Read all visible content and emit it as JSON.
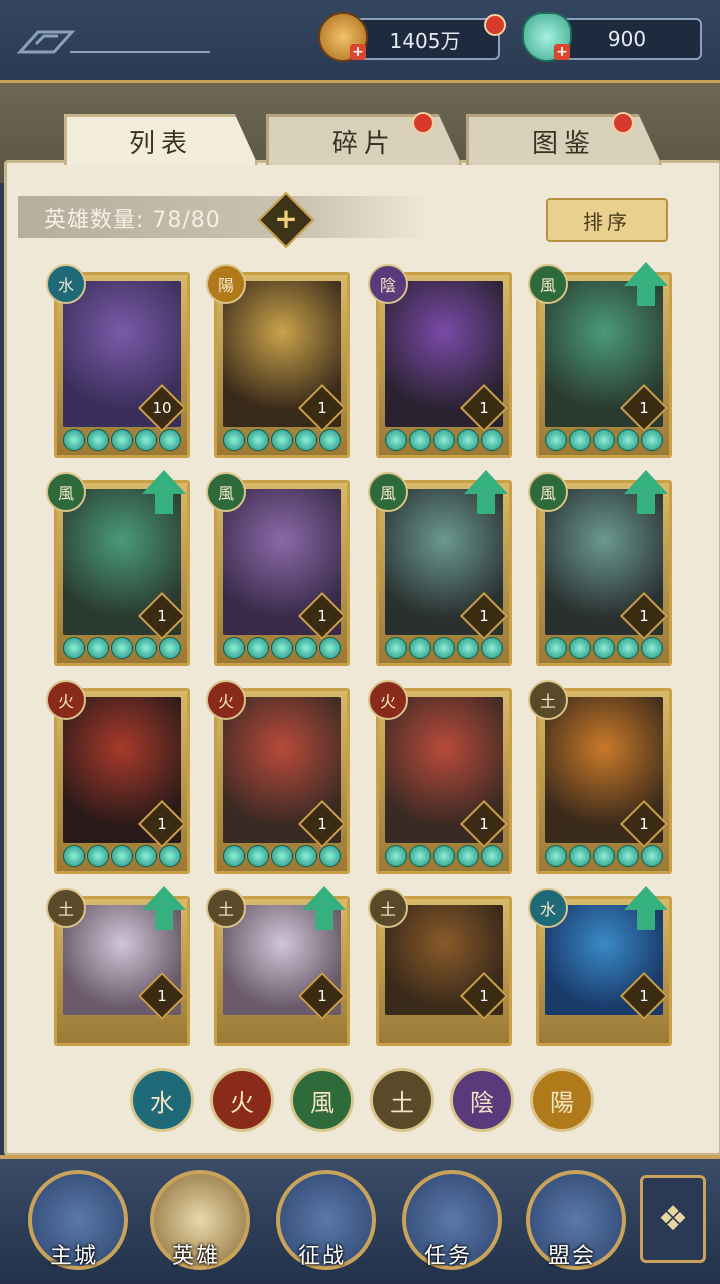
{
  "top": {
    "coins_value": "1405万",
    "gems_value": "900",
    "back_icon": "back-icon"
  },
  "tabs": [
    {
      "label": "列表",
      "active": true,
      "badge": false
    },
    {
      "label": "碎片",
      "active": false,
      "badge": true
    },
    {
      "label": "图鉴",
      "active": false,
      "badge": true
    }
  ],
  "hero_count_label": "英雄数量: 78/80",
  "sort_label": "排序",
  "cards": [
    {
      "element": "水",
      "elem_color": "#1f6a78",
      "level": "10",
      "upgrade": false,
      "art": [
        "#3a2e5a",
        "#7a5aa8"
      ]
    },
    {
      "element": "陽",
      "elem_color": "#b07a1a",
      "level": "1",
      "upgrade": false,
      "art": [
        "#3a2a1a",
        "#c9a24a"
      ]
    },
    {
      "element": "陰",
      "elem_color": "#5a3a7a",
      "level": "1",
      "upgrade": false,
      "art": [
        "#2a2230",
        "#7a4aa8"
      ]
    },
    {
      "element": "風",
      "elem_color": "#2f6a3a",
      "level": "1",
      "upgrade": true,
      "art": [
        "#2a3a2e",
        "#4a9a78"
      ]
    },
    {
      "element": "風",
      "elem_color": "#2f6a3a",
      "level": "1",
      "upgrade": true,
      "art": [
        "#2a3a2e",
        "#4a9a78"
      ]
    },
    {
      "element": "風",
      "elem_color": "#2f6a3a",
      "level": "1",
      "upgrade": false,
      "art": [
        "#3a2a4a",
        "#8a6aa8"
      ]
    },
    {
      "element": "風",
      "elem_color": "#2f6a3a",
      "level": "1",
      "upgrade": true,
      "art": [
        "#2a3030",
        "#6a9a90"
      ]
    },
    {
      "element": "風",
      "elem_color": "#2f6a3a",
      "level": "1",
      "upgrade": true,
      "art": [
        "#2a3030",
        "#6a9a90"
      ]
    },
    {
      "element": "火",
      "elem_color": "#8a2a1a",
      "level": "1",
      "upgrade": false,
      "art": [
        "#2a1a1a",
        "#a83a2a"
      ]
    },
    {
      "element": "火",
      "elem_color": "#8a2a1a",
      "level": "1",
      "upgrade": false,
      "art": [
        "#3a2a24",
        "#b84a3a"
      ]
    },
    {
      "element": "火",
      "elem_color": "#8a2a1a",
      "level": "1",
      "upgrade": false,
      "art": [
        "#3a2a24",
        "#b84a3a"
      ]
    },
    {
      "element": "土",
      "elem_color": "#5a4a2a",
      "level": "1",
      "upgrade": false,
      "art": [
        "#3a2a1a",
        "#c97a2a"
      ]
    },
    {
      "element": "土",
      "elem_color": "#5a4a2a",
      "level": "1",
      "upgrade": true,
      "art": [
        "#6a5a6a",
        "#cfc6d8"
      ]
    },
    {
      "element": "土",
      "elem_color": "#5a4a2a",
      "level": "1",
      "upgrade": true,
      "art": [
        "#6a5a6a",
        "#cfc6d8"
      ]
    },
    {
      "element": "土",
      "elem_color": "#5a4a2a",
      "level": "1",
      "upgrade": false,
      "art": [
        "#3a2a1a",
        "#8a5a2a"
      ]
    },
    {
      "element": "水",
      "elem_color": "#1f6a78",
      "level": "1",
      "upgrade": true,
      "art": [
        "#1a3a6a",
        "#3a8ac8"
      ]
    }
  ],
  "filters": [
    {
      "label": "水",
      "color": "#1f6a78"
    },
    {
      "label": "火",
      "color": "#8a2a1a"
    },
    {
      "label": "風",
      "color": "#2f6a3a"
    },
    {
      "label": "土",
      "color": "#5a4a2a"
    },
    {
      "label": "陰",
      "color": "#5a3a7a"
    },
    {
      "label": "陽",
      "color": "#b07a1a"
    }
  ],
  "nav": [
    {
      "label": "主城",
      "icon": "city-icon"
    },
    {
      "label": "英雄",
      "icon": "hero-icon",
      "active": true
    },
    {
      "label": "征战",
      "icon": "battle-icon"
    },
    {
      "label": "任务",
      "icon": "task-icon"
    },
    {
      "label": "盟会",
      "icon": "guild-icon"
    }
  ],
  "menu_icon": "menu-icon"
}
